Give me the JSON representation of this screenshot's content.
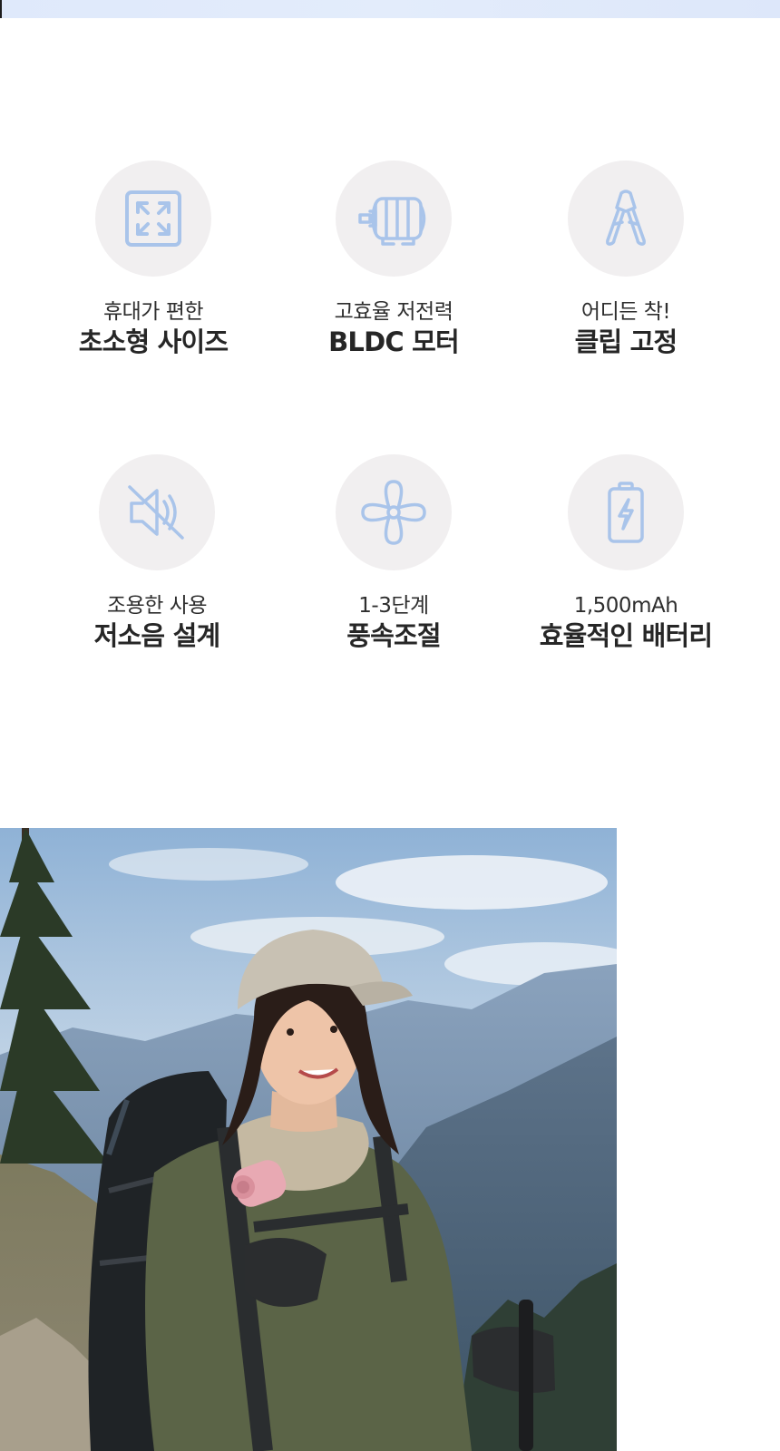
{
  "colors": {
    "icon_stroke": "#a9c4ea",
    "circle_bg": "#f1eff0",
    "top_band": "#e0eafb"
  },
  "features": [
    {
      "icon": "expand-arrows-icon",
      "sub": "휴대가 편한",
      "main": "초소형 사이즈"
    },
    {
      "icon": "motor-icon",
      "sub": "고효율 저전력",
      "main": "BLDC 모터"
    },
    {
      "icon": "clip-icon",
      "sub": "어디든 착!",
      "main": "클립 고정"
    },
    {
      "icon": "mute-speaker-icon",
      "sub": "조용한 사용",
      "main": "저소음 설계"
    },
    {
      "icon": "fan-icon",
      "sub": "1-3단계",
      "main": "풍속조절"
    },
    {
      "icon": "battery-charging-icon",
      "sub": "1,500mAh",
      "main": "효율적인 배터리"
    }
  ],
  "photo": {
    "subject": "hiker-with-neck-fan-photo"
  }
}
